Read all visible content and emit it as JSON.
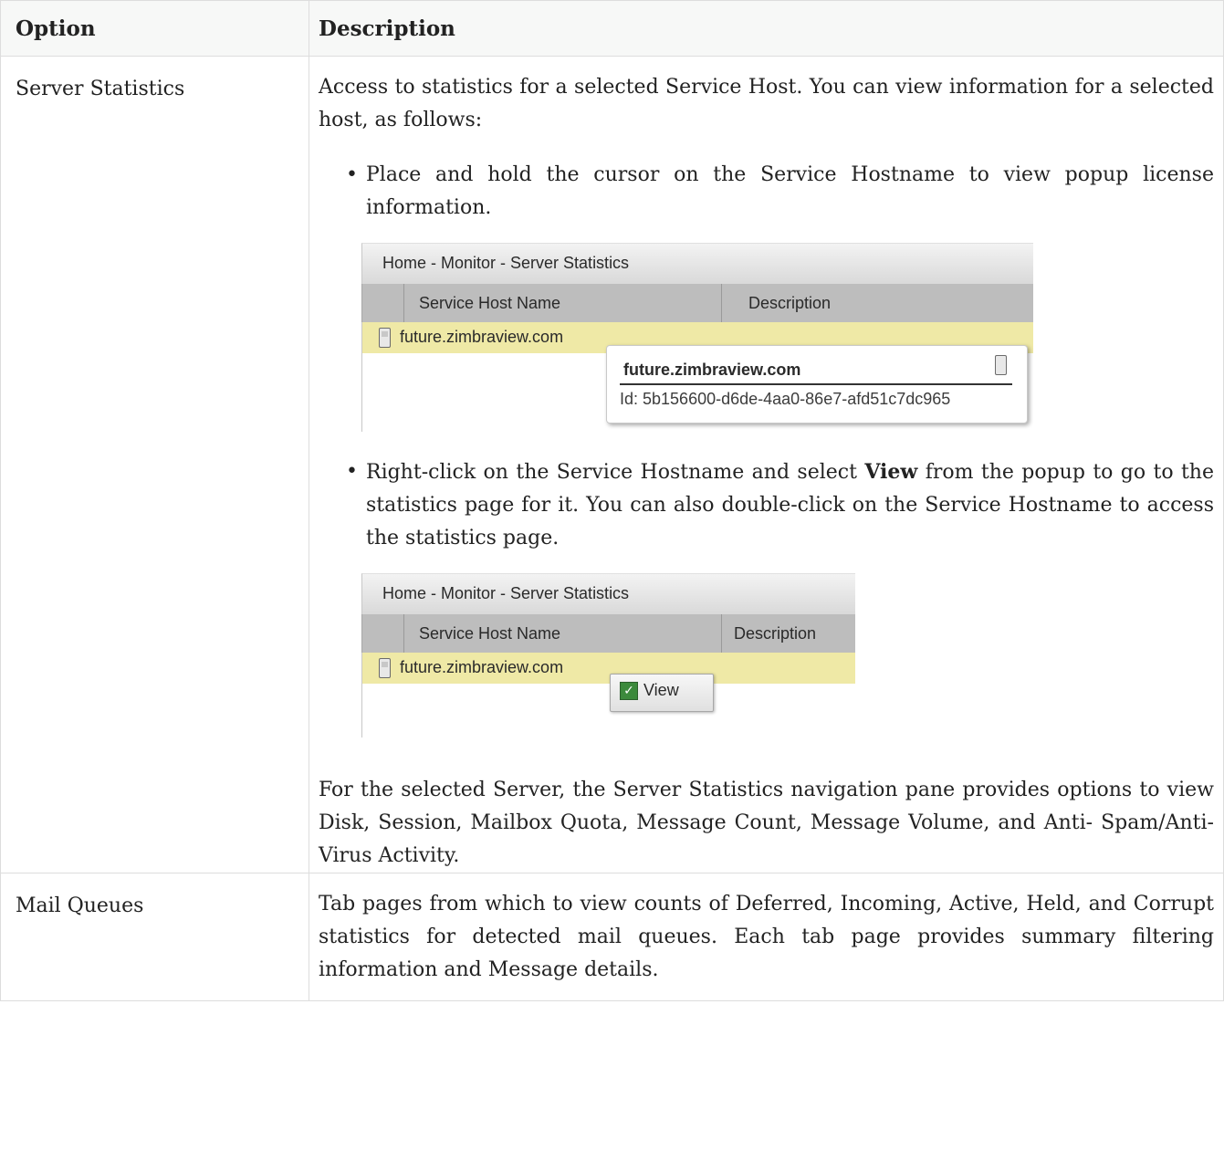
{
  "table": {
    "headers": {
      "option": "Option",
      "description": "Description"
    },
    "rows": [
      {
        "option": "Server Statistics",
        "intro": "Access to statistics for a selected Service Host. You can view information for a selected host, as follows:",
        "bullet1": "Place and hold the cursor on the Service Hostname to view popup license information.",
        "bullet2_pre": "Right-click on the Service Hostname and select ",
        "bullet2_bold": "View",
        "bullet2_post": " from the popup to go to the statistics page for it. You can also double-click on the Service Hostname to access the statistics page.",
        "outro": "For the selected Server, the Server Statistics navigation pane provides options to view Disk, Session, Mailbox Quota, Message Count, Message Volume, and Anti- Spam/Anti-Virus Activity."
      },
      {
        "option": "Mail Queues",
        "description": "Tab pages from which to view counts of Deferred, Incoming, Active, Held, and Corrupt statistics for detected mail queues. Each tab page provides summary filtering information and Message details."
      }
    ]
  },
  "shot1": {
    "breadcrumb": "Home - Monitor - Server Statistics",
    "col_host": "Service Host Name",
    "col_desc": "Description",
    "host": "future.zimbraview.com",
    "tooltip_title": "future.zimbraview.com",
    "tooltip_id": "Id: 5b156600-d6de-4aa0-86e7-afd51c7dc965"
  },
  "shot2": {
    "breadcrumb": "Home - Monitor - Server Statistics",
    "col_host": "Service Host Name",
    "col_desc": "Description",
    "host": "future.zimbraview.com",
    "menu_view": "View"
  }
}
